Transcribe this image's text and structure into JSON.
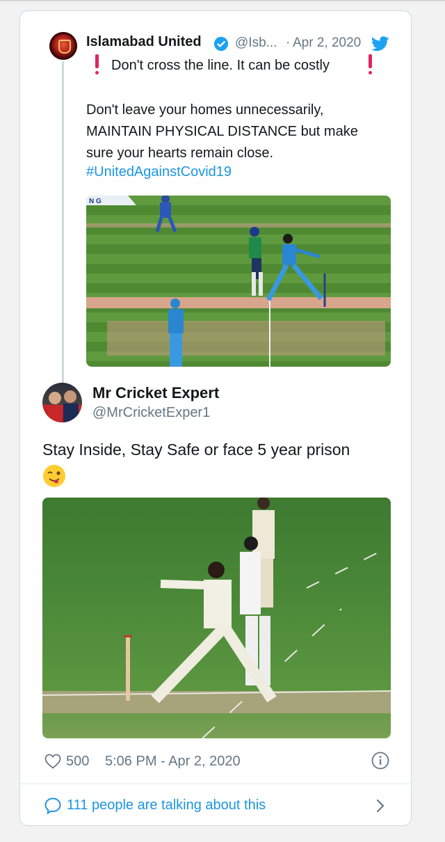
{
  "quoted_tweet": {
    "name": "Islamabad United",
    "handle": "@Isb...",
    "separator": "·",
    "date": "Apr 2, 2020",
    "line1": "Don't cross the line. It can be costly",
    "paragraph": [
      "Don't leave your homes unnecessarily,",
      "MAINTAIN PHYSICAL DISTANCE but make",
      "sure your hearts remain close."
    ],
    "hashtag": "#UnitedAgainstCovid19",
    "image_corner_text": "N G"
  },
  "reply_tweet": {
    "name": "Mr Cricket Expert",
    "handle": "@MrCricketExper1",
    "text": "Stay Inside, Stay Safe or face 5 year prison",
    "emoji": "winking-face-with-tongue"
  },
  "footer": {
    "likes": "500",
    "timestamp": "5:06 PM - Apr 2, 2020",
    "talking_text": "111 people are talking about this"
  },
  "colors": {
    "link": "#1b95e0",
    "muted": "#657786",
    "alert": "#e0245e",
    "verified": "#1da1f2"
  },
  "icons": [
    "verified-icon",
    "twitter-bird-icon",
    "exclamation-icon",
    "heart-icon",
    "info-icon",
    "speech-bubble-icon",
    "chevron-right-icon",
    "wink-emoji"
  ]
}
